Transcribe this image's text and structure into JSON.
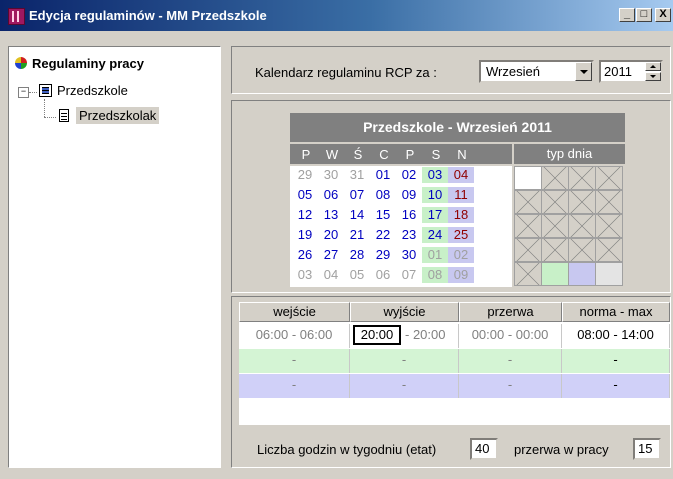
{
  "window": {
    "title": "Edycja regulaminów - MM Przedszkole",
    "buttons": [
      "_",
      "□",
      "X"
    ]
  },
  "tree": {
    "root": {
      "label": "Regulaminy pracy",
      "icon": "balloon-icon"
    },
    "node": {
      "label": "Przedszkole",
      "icon": "building-icon"
    },
    "leaf": {
      "label": "Przedszkolak",
      "icon": "document-icon"
    }
  },
  "header": {
    "label": "Kalendarz regulaminu RCP  za :",
    "month": "Wrzesień",
    "year": "2011"
  },
  "calendar": {
    "title": "Przedszkole - Wrzesień 2011",
    "weekdays": [
      "P",
      "W",
      "Ś",
      "C",
      "P",
      "S",
      "N"
    ],
    "type_label": "typ dnia",
    "weeks": [
      [
        "29",
        "30",
        "31",
        "01",
        "02",
        "03",
        "04"
      ],
      [
        "05",
        "06",
        "07",
        "08",
        "09",
        "10",
        "11"
      ],
      [
        "12",
        "13",
        "14",
        "15",
        "16",
        "17",
        "18"
      ],
      [
        "19",
        "20",
        "21",
        "22",
        "23",
        "24",
        "25"
      ],
      [
        "26",
        "27",
        "28",
        "29",
        "30",
        "01",
        "02"
      ],
      [
        "03",
        "04",
        "05",
        "06",
        "07",
        "08",
        "09"
      ]
    ],
    "colors": {
      "saturday_bg": "#c8f0c8",
      "sunday_bg": "#c8c8f0",
      "sunday_text": "#900000",
      "current_text": "#0000c0",
      "other_text": "#a0a0a0"
    }
  },
  "grid": {
    "headers": [
      "wejście",
      "wyjście",
      "przerwa",
      "norma - max"
    ],
    "row1": {
      "wejscie": "06:00 - 06:00",
      "wyjscie_start": "20:00",
      "wyjscie_end": "- 20:00",
      "przerwa": "00:00 - 00:00",
      "norma": "08:00 - 14:00"
    },
    "row2": [
      "-",
      "-",
      "-",
      "-"
    ],
    "row3": [
      "-",
      "-",
      "-",
      "-"
    ],
    "row_colors": [
      "#ffffff",
      "#d4f4d4",
      "#d0d0f8"
    ]
  },
  "footer": {
    "hours_label": "Liczba godzin w tygodniu (etat)",
    "hours_value": "40",
    "break_label": "przerwa w pracy",
    "break_value": "15"
  }
}
